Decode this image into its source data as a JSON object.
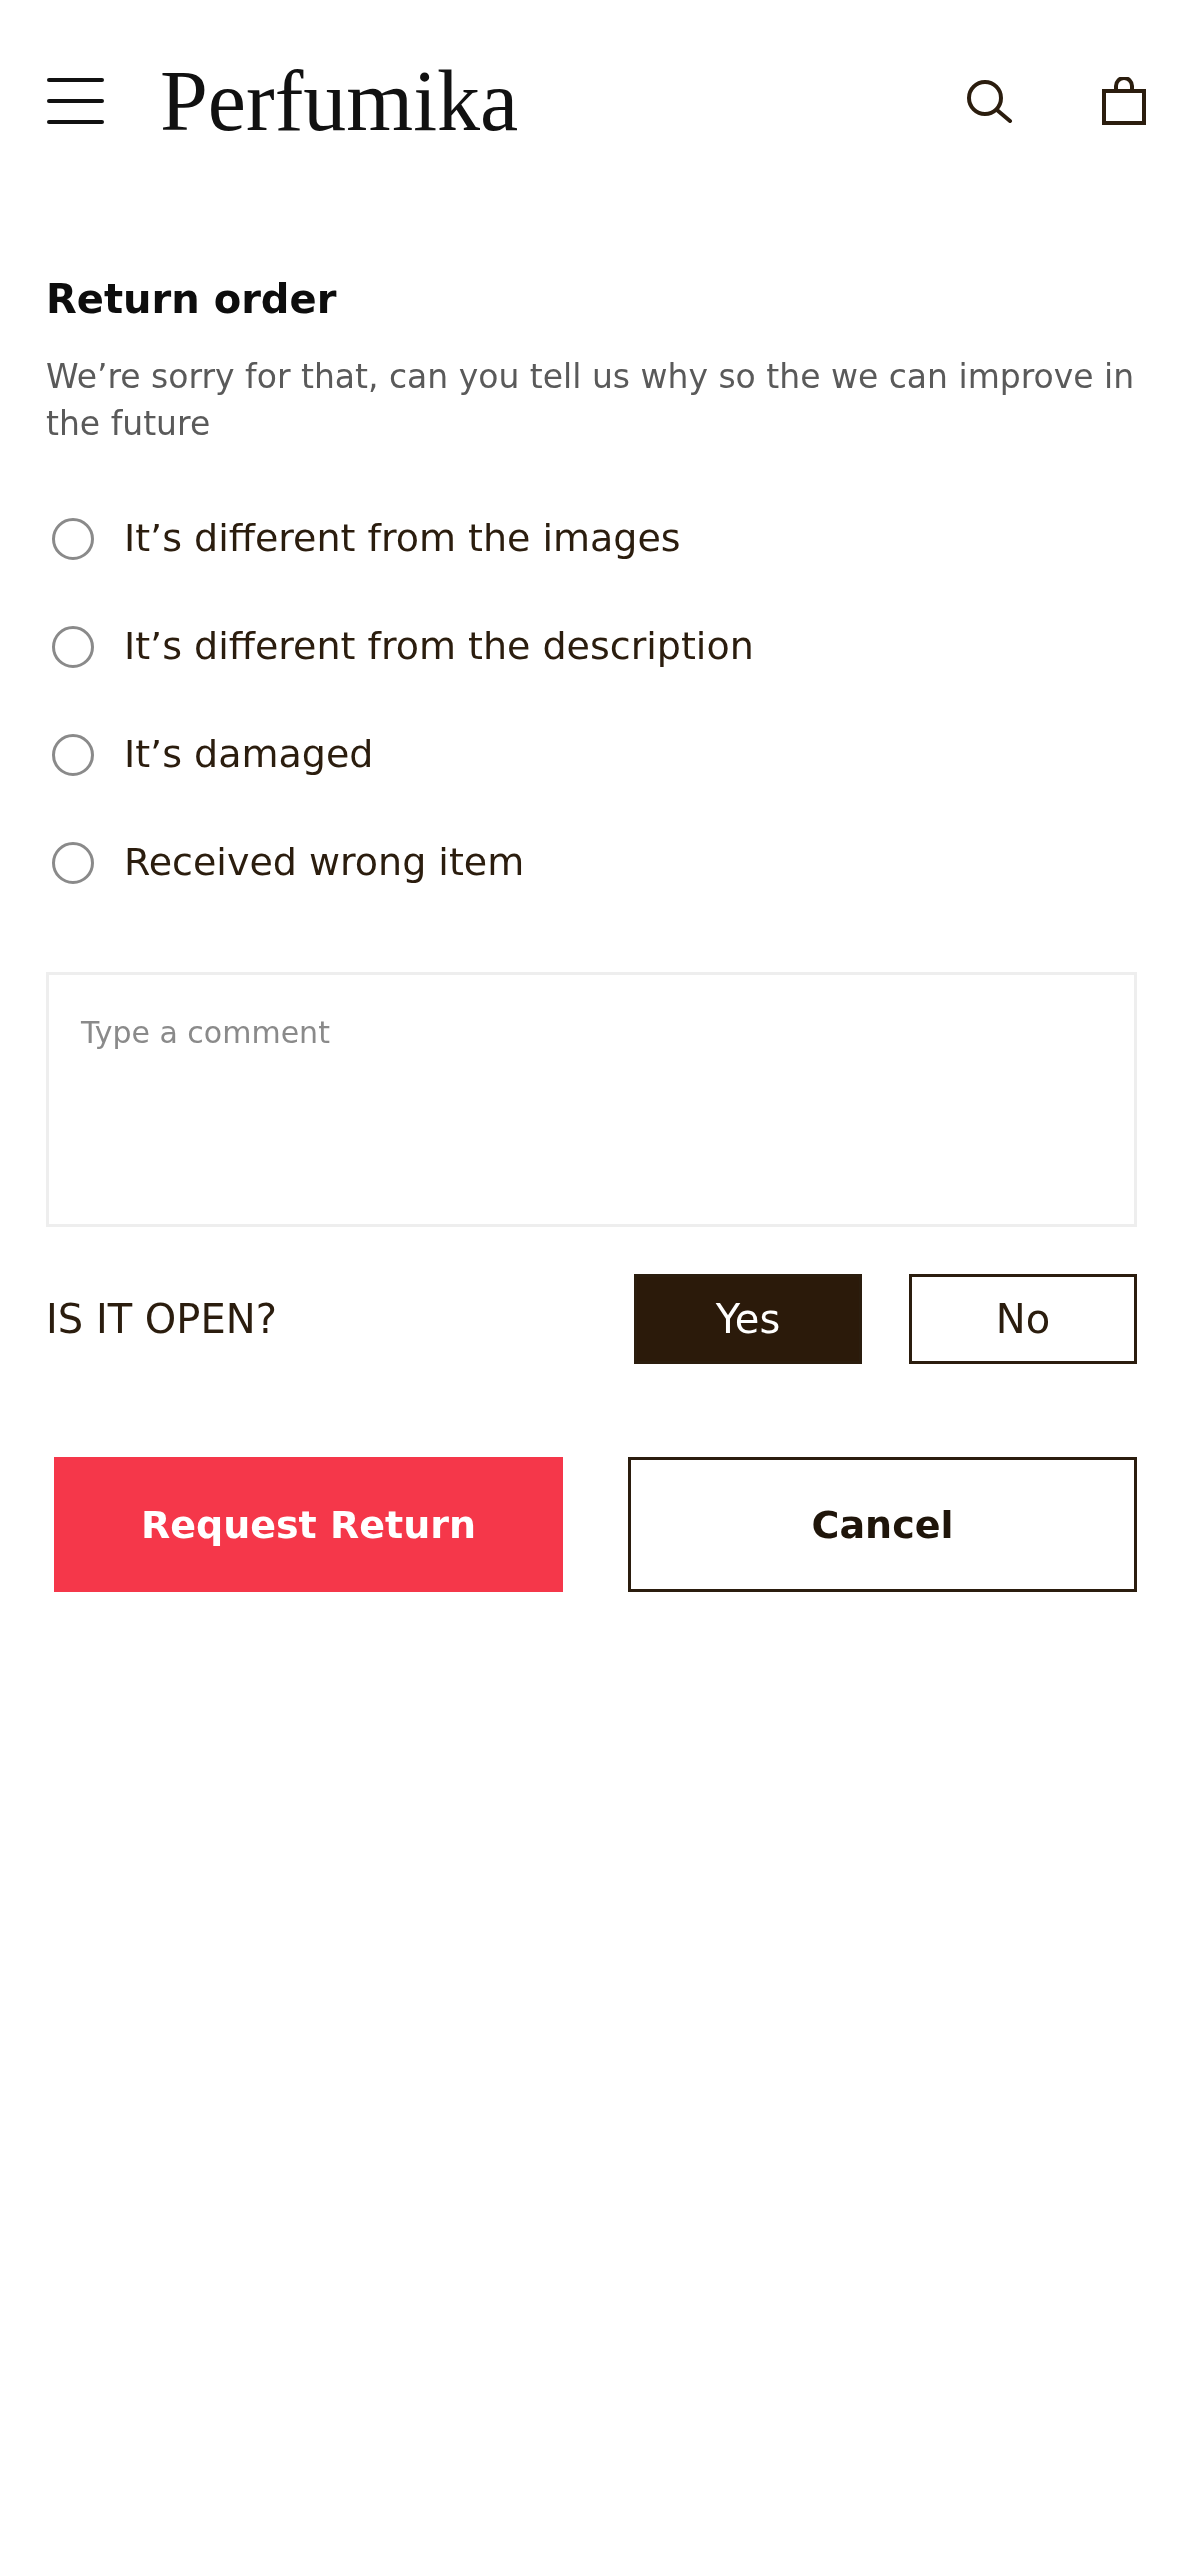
{
  "header": {
    "logo": "Perfumika"
  },
  "form": {
    "title": "Return order",
    "subtitle": "We’re sorry for that, can you tell us why so the we can improve in the future",
    "reasons": [
      {
        "label": "It’s different from the images",
        "selected": false
      },
      {
        "label": "It’s different from the description",
        "selected": false
      },
      {
        "label": "It’s damaged",
        "selected": false
      },
      {
        "label": "Received wrong item",
        "selected": false
      }
    ],
    "comment": {
      "placeholder": "Type a comment"
    },
    "open_question": {
      "label": "IS IT OPEN?",
      "options": [
        {
          "label": "Yes",
          "selected": true
        },
        {
          "label": "No",
          "selected": false
        }
      ]
    },
    "actions": [
      {
        "label": "Request Return",
        "kind": "primary"
      },
      {
        "label": "Cancel",
        "kind": "secondary"
      }
    ]
  }
}
